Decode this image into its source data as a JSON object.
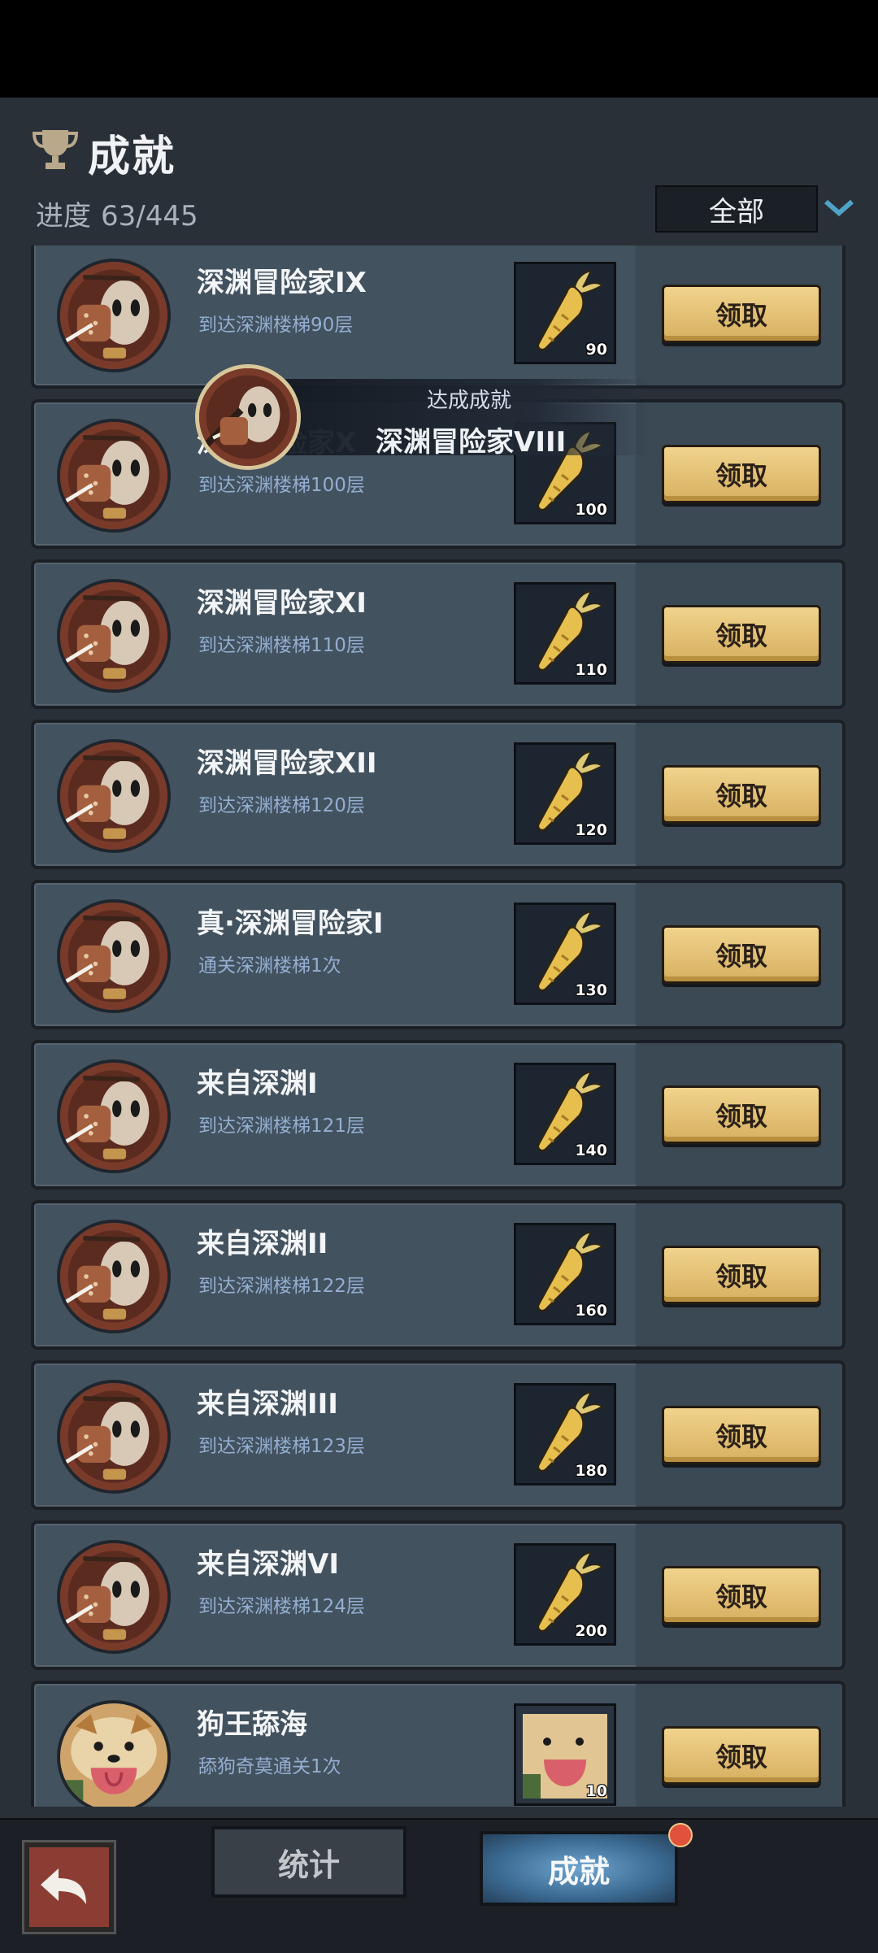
{
  "header": {
    "title": "成就",
    "progress_label": "进度",
    "progress_value": "63/445",
    "filter_value": "全部"
  },
  "toast": {
    "subtitle": "达成成就",
    "name": "深渊冒险家VIII"
  },
  "achievements": [
    {
      "title": "深渊冒险家IX",
      "desc": "到达深渊楼梯90层",
      "reward": "90",
      "reward_icon": "carrot-icon",
      "avatar": "masked-adventurer",
      "button": "领取"
    },
    {
      "title": "深渊冒险家X",
      "desc": "到达深渊楼梯100层",
      "reward": "100",
      "reward_icon": "carrot-icon",
      "avatar": "masked-adventurer",
      "button": "领取"
    },
    {
      "title": "深渊冒险家XI",
      "desc": "到达深渊楼梯110层",
      "reward": "110",
      "reward_icon": "carrot-icon",
      "avatar": "masked-adventurer",
      "button": "领取"
    },
    {
      "title": "深渊冒险家XII",
      "desc": "到达深渊楼梯120层",
      "reward": "120",
      "reward_icon": "carrot-icon",
      "avatar": "masked-adventurer",
      "button": "领取"
    },
    {
      "title": "真·深渊冒险家I",
      "desc": "通关深渊楼梯1次",
      "reward": "130",
      "reward_icon": "carrot-icon",
      "avatar": "masked-adventurer",
      "button": "领取"
    },
    {
      "title": "来自深渊I",
      "desc": "到达深渊楼梯121层",
      "reward": "140",
      "reward_icon": "carrot-icon",
      "avatar": "masked-adventurer",
      "button": "领取"
    },
    {
      "title": "来自深渊II",
      "desc": "到达深渊楼梯122层",
      "reward": "160",
      "reward_icon": "carrot-icon",
      "avatar": "masked-adventurer",
      "button": "领取"
    },
    {
      "title": "来自深渊III",
      "desc": "到达深渊楼梯123层",
      "reward": "180",
      "reward_icon": "carrot-icon",
      "avatar": "masked-adventurer",
      "button": "领取"
    },
    {
      "title": "来自深渊VI",
      "desc": "到达深渊楼梯124层",
      "reward": "200",
      "reward_icon": "carrot-icon",
      "avatar": "masked-adventurer",
      "button": "领取"
    },
    {
      "title": "狗王舔海",
      "desc": "舔狗奇莫通关1次",
      "reward": "10",
      "reward_icon": "shiba-dog-icon",
      "avatar": "shiba-dog",
      "button": "领取"
    }
  ],
  "footer": {
    "tab_stats": "统计",
    "tab_achievements": "成就"
  },
  "colors": {
    "panel_bg": "#2a3038",
    "card_bg": "#43525f",
    "claim_button": "#e6c27a",
    "desc_text": "#93aed0",
    "active_tab": "#5f95c2",
    "badge": "#e0523b"
  }
}
